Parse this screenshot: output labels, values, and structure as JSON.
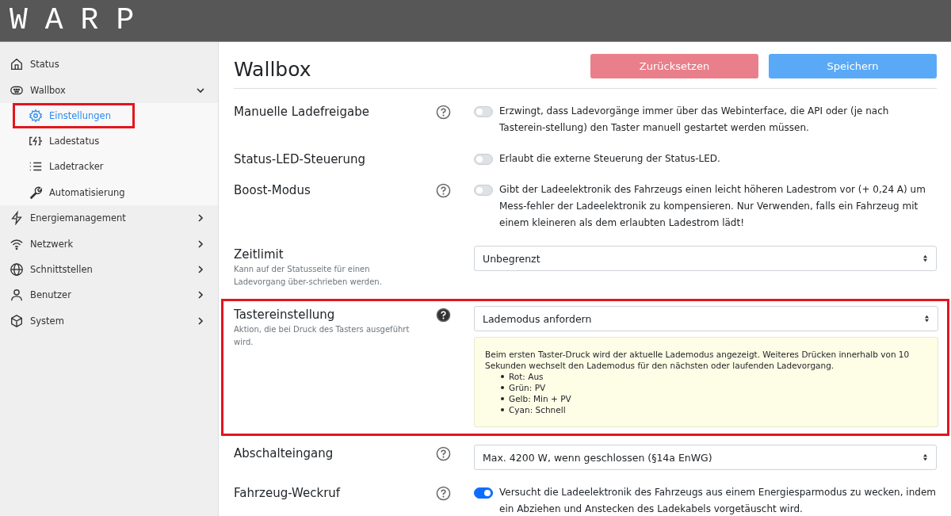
{
  "logo": "WARP",
  "sidebar": {
    "items": [
      {
        "label": "Status"
      },
      {
        "label": "Wallbox",
        "expanded": true,
        "children": [
          {
            "label": "Einstellungen",
            "selected": true,
            "highlighted": true
          },
          {
            "label": "Ladestatus",
            "selected": false,
            "highlighted": false
          },
          {
            "label": "Ladetracker",
            "selected": false,
            "highlighted": false
          },
          {
            "label": "Automatisierung",
            "selected": false,
            "highlighted": false
          }
        ]
      },
      {
        "label": "Energiemanagement",
        "expanded": false
      },
      {
        "label": "Netzwerk",
        "expanded": false
      },
      {
        "label": "Schnittstellen",
        "expanded": false
      },
      {
        "label": "Benutzer",
        "expanded": false
      },
      {
        "label": "System",
        "expanded": false
      }
    ]
  },
  "page": {
    "title": "Wallbox",
    "buttons": [
      {
        "label": "Zurücksetzen",
        "kind": "reset"
      },
      {
        "label": "Speichern",
        "kind": "save"
      }
    ]
  },
  "settings": [
    {
      "kind": "switch",
      "label": "Manuelle Ladefreigabe",
      "help": true,
      "on": false,
      "text": "Erzwingt, dass Ladevorgänge immer über das Webinterface, die API oder (je nach Tasterein-stellung) den Taster manuell gestartet werden müssen.",
      "highlighted": false
    },
    {
      "kind": "switch",
      "label": "Status-LED-Steuerung",
      "help": false,
      "on": false,
      "text": "Erlaubt die externe Steuerung der Status-LED.",
      "highlighted": false
    },
    {
      "kind": "switch",
      "label": "Boost-Modus",
      "help": true,
      "on": false,
      "text": "Gibt der Ladeelektronik des Fahrzeugs einen leicht höheren Ladestrom vor (+ 0,24 A) um Mess-fehler der Ladeelektronik zu kompensieren. Nur Verwenden, falls ein Fahrzeug mit einem kleineren als dem erlaubten Ladestrom lädt!",
      "highlighted": false
    },
    {
      "kind": "select",
      "label": "Zeitlimit",
      "hint": "Kann auf der Statusseite für einen Ladevorgang über-schrieben werden.",
      "help": false,
      "value": "Unbegrenzt",
      "highlighted": false
    },
    {
      "kind": "select",
      "label": "Tastereinstellung",
      "hint": "Aktion, die bei Druck des Tasters ausgeführt wird.",
      "help": true,
      "help_active": true,
      "value": "Lademodus anfordern",
      "highlighted": true,
      "note": {
        "text": "Beim ersten Taster-Druck wird der aktuelle Lademodus angezeigt. Weiteres Drücken innerhalb von 10 Sekunden wechselt den Lademodus für den nächsten oder laufenden Ladevorgang.",
        "items": [
          "Rot: Aus",
          "Grün: PV",
          "Gelb: Min + PV",
          "Cyan: Schnell"
        ]
      }
    },
    {
      "kind": "select",
      "label": "Abschalteingang",
      "help": true,
      "value": "Max. 4200 W, wenn geschlossen (§14a EnWG)",
      "highlighted": false
    },
    {
      "kind": "switch",
      "label": "Fahrzeug-Weckruf",
      "help": true,
      "on": true,
      "text": "Versucht die Ladeelektronik des Fahrzeugs aus einem Energiesparmodus zu wecken, indem ein Abziehen und Anstecken des Ladekabels vorgetäuscht wird.",
      "highlighted": false
    }
  ]
}
